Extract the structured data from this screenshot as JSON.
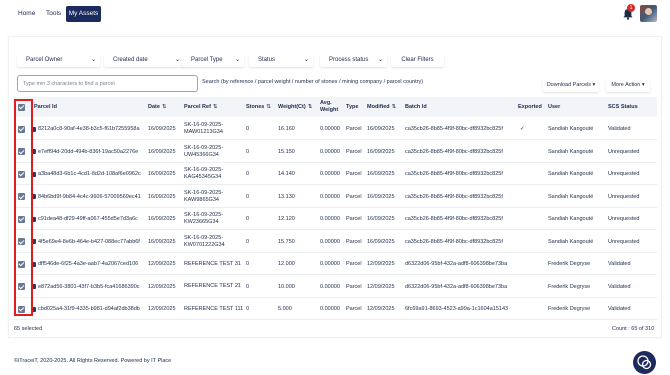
{
  "nav": {
    "home": "Home",
    "tools": "Tools",
    "my_assets": "My Assets"
  },
  "notifications": {
    "badge": "1"
  },
  "filters": {
    "parcel_owner": "Parcel Owner",
    "created_date": "Created date",
    "parcel_type": "Parcel Type",
    "status": "Status",
    "process_status": "Process status",
    "clear": "Clear Filters"
  },
  "search": {
    "placeholder": "Type min 3 characters to find a parcel",
    "hint": "Search (by reference / parcel weight / number of stones / mining company / parcel country)"
  },
  "actions": {
    "download": "Download Parcels ▾",
    "more": "More Action ▾"
  },
  "columns": {
    "parcel_id": "Parcel Id",
    "date": "Date",
    "parcel_ref": "Parcel Ref",
    "stones": "Stones",
    "weight": "Weight(Ct)",
    "avg_weight": "Avg. Weight",
    "type": "Type",
    "modified": "Modified",
    "batch_id": "Batch Id",
    "exported": "Exported",
    "user": "User",
    "scs_status": "SCS Status",
    "sort_glyph": "⇅"
  },
  "rows": [
    {
      "id": "8212a0c8-90af-4e38-b3c5-f61b7255958a",
      "date": "16/09/2025",
      "ref": "SK-16-09-2025-MAW01213G34",
      "stones": "0",
      "weight": "16.160",
      "avg": "0.00000",
      "type": "Parcel",
      "modified": "16/09/2025",
      "batch": "ca35cb26-8b85-4f9f-80bc-df8932bc825f",
      "exported": "✓",
      "user": "Sandiah Kangouté",
      "status": "Validated"
    },
    {
      "id": "e7eff94d-20dd-494b-836f-19ac50a2276e",
      "date": "16/09/2025",
      "ref": "SK-16-09-2025-UW45366G34",
      "stones": "0",
      "weight": "15.150",
      "avg": "0.00000",
      "type": "Parcel",
      "modified": "16/09/2025",
      "batch": "ca35cb26-8b85-4f9f-80bc-df8932bc825f",
      "exported": "",
      "user": "Sandiah Kangouté",
      "status": "Unrequested"
    },
    {
      "id": "a3ba48d3-6b1c-4cd1-8d2d-108af6e0962c",
      "date": "16/09/2025",
      "ref": "SK-16-09-2025-KAG45345G34",
      "stones": "0",
      "weight": "14.140",
      "avg": "0.00000",
      "type": "Parcel",
      "modified": "16/09/2025",
      "batch": "ca35cb26-8b85-4f9f-80bc-df8932bc825f",
      "exported": "",
      "user": "Sandiah Kangouté",
      "status": "Unrequested"
    },
    {
      "id": "84b6bd9f-9b84-4c4c-9606-57009569ec41",
      "date": "16/09/2025",
      "ref": "SK-16-09-2025-KAW9865G34",
      "stones": "0",
      "weight": "13.130",
      "avg": "0.00000",
      "type": "Parcel",
      "modified": "16/09/2025",
      "batch": "ca35cb26-8b85-4f9f-80bc-df8932bc825f",
      "exported": "",
      "user": "Sandiah Kangouté",
      "status": "Unrequested"
    },
    {
      "id": "c91dea48-df29-49ff-a067-455d5e7d3a6c",
      "date": "16/09/2025",
      "ref": "SK-16-09-2025-KW23665G34",
      "stones": "0",
      "weight": "12.120",
      "avg": "0.00000",
      "type": "Parcel",
      "modified": "16/09/2025",
      "batch": "ca35cb26-8b85-4f9f-80bc-df8932bc825f",
      "exported": "",
      "user": "Sandiah Kangouté",
      "status": "Unrequested"
    },
    {
      "id": "4f5e69e4-8e6b-464e-b427-088ec77abb6f",
      "date": "16/09/2025",
      "ref": "SK-16-09-2025-KW0701222G34",
      "stones": "0",
      "weight": "15.750",
      "avg": "0.00000",
      "type": "Parcel",
      "modified": "16/09/2025",
      "batch": "ca35cb26-8b85-4f9f-80bc-df8932bc825f",
      "exported": "",
      "user": "Sandiah Kangouté",
      "status": "Unrequested"
    },
    {
      "id": "dff546de-6f25-4a3e-aab7-4a2067ced106",
      "date": "12/09/2025",
      "ref": "REFERENCE TEST 31",
      "stones": "0",
      "weight": "12.000",
      "avg": "0.00000",
      "type": "Parcel",
      "modified": "12/09/2025",
      "batch": "d6322d06-95bf-432a-adf8-606398be73ba",
      "exported": "",
      "user": "Frederik Degryse",
      "status": "Validated"
    },
    {
      "id": "e872ad56-3801-43f7-b3b5-fca41686390c",
      "date": "12/09/2025",
      "ref": "REFERENCE TEST 21",
      "stones": "0",
      "weight": "10.000",
      "avg": "0.00000",
      "type": "Parcel",
      "modified": "12/09/2025",
      "batch": "d6322d06-95bf-432a-adf8-606398be73ba",
      "exported": "",
      "user": "Frederik Degryse",
      "status": "Validated"
    },
    {
      "id": "cbd025a4-31f9-4335-b981-d94af2db38db",
      "date": "12/09/2025",
      "ref": "REFERENCE TEST 111",
      "stones": "0",
      "weight": "5.000",
      "avg": "0.00000",
      "type": "Parcel",
      "modified": "12/09/2025",
      "batch": "6fc69a91-8693-4523-a99a-1c1604a15143",
      "exported": "",
      "user": "Frederik Degryse",
      "status": "Validated"
    }
  ],
  "footer": {
    "selected": "65 selected",
    "count": "Count : 65 of 310"
  },
  "copyright": "©iTraceiT, 2020-2025. All Rights Reserved. Powered by IT Place",
  "colors": {
    "accent": "#1c2a5e",
    "highlight": "#e01e1e",
    "badge": "#d42b2b"
  }
}
